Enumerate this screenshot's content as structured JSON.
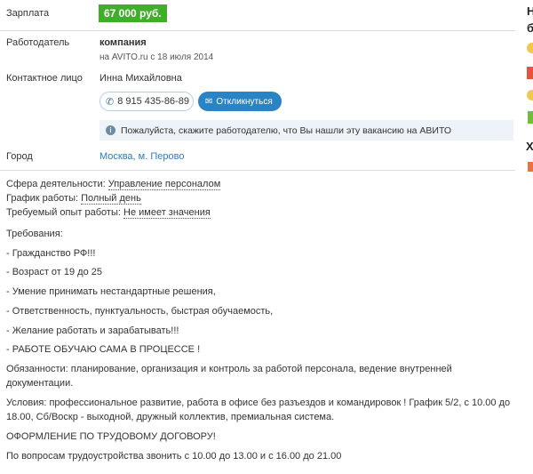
{
  "salary": {
    "label": "Зарплата",
    "value": "67 000 руб."
  },
  "employer": {
    "label": "Работодатель",
    "name": "компания",
    "since": "на AVITO.ru с 18 июля 2014"
  },
  "contact": {
    "label": "Контактное лицо",
    "name": "Инна Михайловна",
    "phone": "8 915 435-86-89",
    "respond_label": "Откликнуться",
    "hint": "Пожалуйста, скажите работодателю, что Вы нашли эту вакансию на АВИТО"
  },
  "city": {
    "label": "Город",
    "value": "Москва, м. Перово"
  },
  "details": {
    "sphere_label": "Сфера деятельности:",
    "sphere_value": "Управление персоналом",
    "schedule_label": "График работы:",
    "schedule_value": "Полный день",
    "experience_label": "Требуемый опыт работы:",
    "experience_value": "Не имеет значения"
  },
  "description": {
    "requirements_title": "Требования:",
    "items": [
      "- Гражданство РФ!!!",
      "- Возраст от 19 до 25",
      "- Умение принимать нестандартные решения,",
      "- Ответственность, пунктуальность, быстрая обучаемость,",
      "- Желание работать и зарабатывать!!!",
      "- РАБОТЕ ОБУЧАЮ САМА В ПРОЦЕССЕ !"
    ],
    "duties_line1": "Обязанности: планирование, организация и контроль за работой персонала, ведение внутренней",
    "duties_line2": "документации.",
    "conditions_line1": "Условия: профессиональное развитие, работа в офисе без разъездов и командировок ! График 5/2, с 10.00 до",
    "conditions_line2": "18.00, Сб/Воскр - выходной, дружный коллектив, премиальная система.",
    "contract": "ОФОРМЛЕНИЕ ПО ТРУДОВОМУ ДОГОВОРУ!",
    "calls": "По вопросам трудоустройства звонить с 10.00 до 13.00 и с 16.00 до 21.00"
  },
  "sidebar_fragment": {
    "t1": "Н",
    "t2": "б",
    "t3": "Х"
  },
  "colors": {
    "salary_bg": "#3fae29",
    "link": "#2b7bbf",
    "button": "#2a83c5",
    "hint_bg": "#edf3f8"
  }
}
